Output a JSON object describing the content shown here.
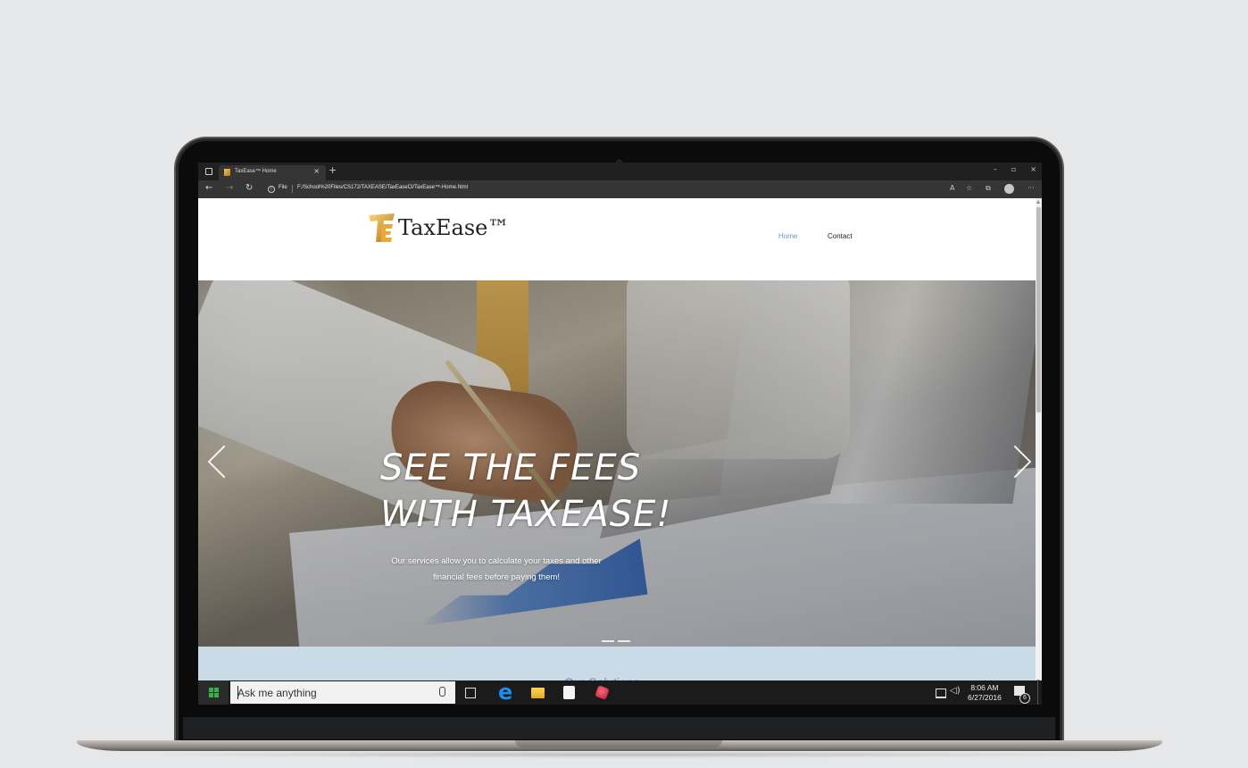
{
  "browser": {
    "tab_title": "TaxEase™ Home",
    "tab_close": "×",
    "new_tab": "+",
    "window_controls": {
      "minimize": "–",
      "maximize": "▫",
      "close": "×"
    },
    "nav": {
      "back": "←",
      "forward": "→",
      "refresh": "↻"
    },
    "address": {
      "security_label": "File",
      "url": "F:/School%20Files/CS172/TAXEASE/TaxEaseCl/TaxEase™-Home.html"
    }
  },
  "site": {
    "logo_text": "TaxEase™",
    "nav": {
      "home": "Home",
      "contact": "Contact"
    },
    "hero": {
      "title_line1": "SEE THE FEES",
      "title_line2": "WITH TAXEASE!",
      "subtitle": "Our services allow you to calculate your taxes and other financial fees before paying them!"
    },
    "services_heading": "Our Solutions"
  },
  "taskbar": {
    "search_placeholder": "Ask me anything",
    "time": "8:06 AM",
    "date": "6/27/2016",
    "notification_count": "6"
  },
  "colors": {
    "nav_active": "#6f93c2",
    "services_bg": "#c9dbe6",
    "taskbar_bg": "#1b1b1b"
  }
}
